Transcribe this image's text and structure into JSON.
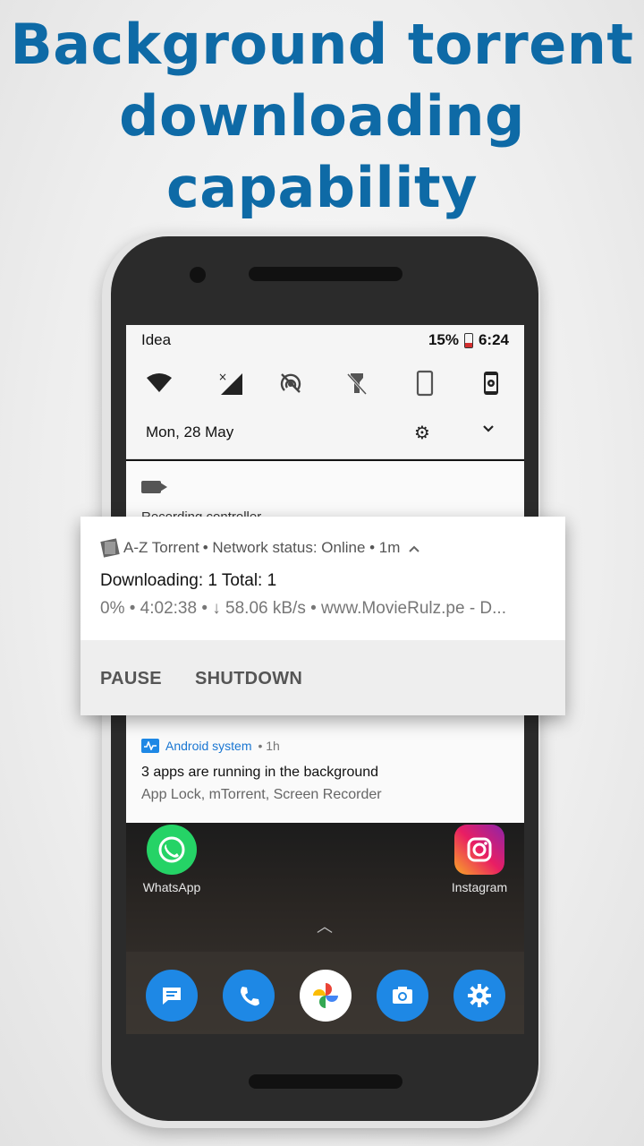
{
  "headline": [
    "Background torrent",
    "downloading",
    "capability"
  ],
  "status_bar": {
    "carrier": "Idea",
    "battery": "15%",
    "time": "6:24"
  },
  "quick_settings": [
    "wifi-icon",
    "no-signal-icon",
    "hotspot-off-icon",
    "flashlight-off-icon",
    "rotation-icon",
    "screen-cast-icon"
  ],
  "shade": {
    "date": "Mon, 28 May"
  },
  "recording_card": {
    "label": "Recording controller"
  },
  "torrent_notification": {
    "app": "A-Z Torrent",
    "header_rest": "• Network status: Online • 1m",
    "title": "Downloading: 1 Total: 1",
    "subtitle": "0% • 4:02:38 • ↓ 58.06 kB/s • www.MovieRulz.pe - D...",
    "actions": [
      "PAUSE",
      "SHUTDOWN"
    ]
  },
  "system_notification": {
    "app": "Android system",
    "time": "• 1h",
    "title": "3 apps are running in the background",
    "subtitle": "App Lock, mTorrent, Screen Recorder"
  },
  "home_apps": [
    "WhatsApp",
    "Instagram"
  ],
  "dock": [
    "messages-icon",
    "phone-icon",
    "photos-icon",
    "camera-icon",
    "settings-icon"
  ],
  "colors": {
    "headline": "#0e6aa6",
    "link_blue": "#1976d2"
  }
}
